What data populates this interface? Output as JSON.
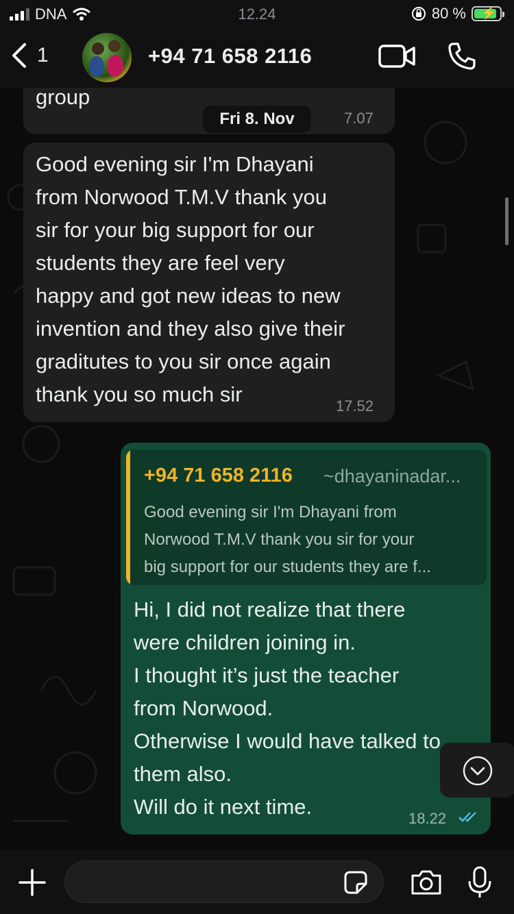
{
  "status": {
    "carrier": "DNA",
    "time": "12.24",
    "battery": "80 %"
  },
  "header": {
    "back_count": "1",
    "contact": "+94 71 658 2116"
  },
  "chat": {
    "partial_message": {
      "text": "group",
      "time": "7.07"
    },
    "date_label": "Fri 8. Nov",
    "incoming": {
      "lines": [
        "Good evening sir I'm Dhayani",
        "from Norwood T.M.V thank you",
        "sir for your big support for our",
        "students they are feel very",
        "happy and got new ideas to new",
        "invention and they also give their",
        "graditutes to you sir once again",
        "thank you so much sir"
      ],
      "time": "17.52"
    },
    "outgoing": {
      "quote": {
        "name": "+94 71 658 2116",
        "handle": "~dhayaninadar...",
        "lines": [
          "Good evening sir I'm Dhayani from",
          "Norwood T.M.V thank you sir for your",
          "big support for our students they are f..."
        ]
      },
      "lines": [
        "Hi, I did not realize that there",
        "were children joining in.",
        "I thought it’s just the teacher",
        "from Norwood.",
        "Otherwise I would have talked to",
        "them also.",
        "Will do it next time."
      ],
      "time": "18.22"
    }
  },
  "colors": {
    "incoming_bubble": "#1f1f1f",
    "outgoing_bubble": "#134d37",
    "quote_accent": "#f0b429",
    "read_ticks": "#53bdeb"
  },
  "icons": [
    "chevron-left-icon",
    "video-call-icon",
    "phone-icon",
    "plus-icon",
    "sticker-icon",
    "camera-icon",
    "microphone-icon",
    "chevron-down-icon",
    "signal-icon",
    "wifi-icon",
    "battery-icon",
    "orientation-lock-icon"
  ]
}
